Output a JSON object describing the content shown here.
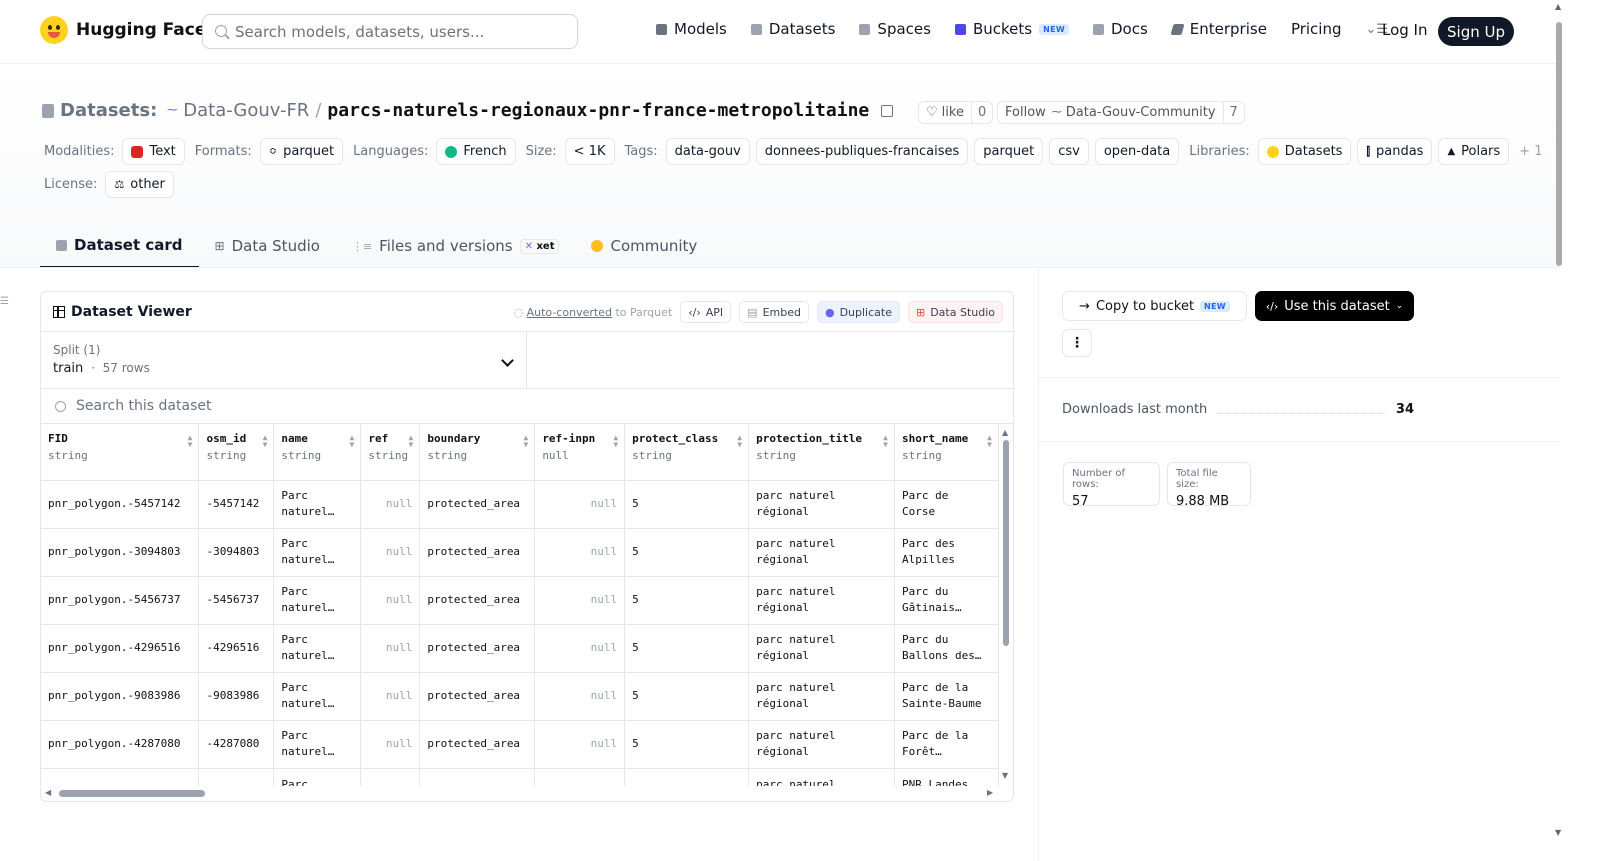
{
  "nav": {
    "brand": "Hugging Face",
    "search_placeholder": "Search models, datasets, users...",
    "items": [
      {
        "label": "Models",
        "icon": "models-icon",
        "color": "#6b7280"
      },
      {
        "label": "Datasets",
        "icon": "datasets-icon",
        "color": "#9ca3af"
      },
      {
        "label": "Spaces",
        "icon": "spaces-icon",
        "color": "#9ca3af"
      },
      {
        "label": "Buckets",
        "icon": "buckets-icon",
        "color": "#4f46e5",
        "badge": "NEW"
      },
      {
        "label": "Docs",
        "icon": "docs-icon",
        "color": "#9ca3af"
      },
      {
        "label": "Enterprise",
        "icon": "enterprise-icon",
        "color": "#6b7280"
      },
      {
        "label": "Pricing"
      }
    ],
    "login": "Log In",
    "signup": "Sign Up"
  },
  "repo": {
    "type_label": "Datasets:",
    "org": "Data-Gouv-FR",
    "slash": "/",
    "name": "parcs-naturels-regionaux-pnr-france-metropolitaine",
    "like_label": "like",
    "like_count": "0",
    "follow_label": "Follow",
    "follow_org": "Data-Gouv-Community",
    "follow_count": "7"
  },
  "tags": {
    "modalities_label": "Modalities:",
    "modalities": "Text",
    "formats_label": "Formats:",
    "formats": "parquet",
    "languages_label": "Languages:",
    "languages": "French",
    "size_label": "Size:",
    "size": "< 1K",
    "tags_label": "Tags:",
    "tags": [
      "data-gouv",
      "donnees-publiques-francaises",
      "parquet",
      "csv",
      "open-data"
    ],
    "libraries_label": "Libraries:",
    "libraries": [
      "Datasets",
      "pandas",
      "Polars"
    ],
    "libraries_more": "+ 1",
    "license_label": "License:",
    "license": "other"
  },
  "tabs": [
    {
      "label": "Dataset card",
      "active": true
    },
    {
      "label": "Data Studio"
    },
    {
      "label": "Files and versions",
      "badge": "xet"
    },
    {
      "label": "Community"
    }
  ],
  "viewer": {
    "title": "Dataset Viewer",
    "autoconverted": "Auto-converted",
    "to_parquet": "to Parquet",
    "api": "API",
    "embed": "Embed",
    "duplicate": "Duplicate",
    "data_studio": "Data Studio",
    "split_label": "Split (1)",
    "split_name": "train",
    "split_rows": "57 rows",
    "search_placeholder": "Search this dataset",
    "columns": [
      {
        "name": "FID",
        "type": "string"
      },
      {
        "name": "osm_id",
        "type": "string"
      },
      {
        "name": "name",
        "type": "string"
      },
      {
        "name": "ref",
        "type": "string"
      },
      {
        "name": "boundary",
        "type": "string"
      },
      {
        "name": "ref-inpn",
        "type": "null"
      },
      {
        "name": "protect_class",
        "type": "string"
      },
      {
        "name": "protection_title",
        "type": "string"
      },
      {
        "name": "short_name",
        "type": "string"
      }
    ],
    "rows": [
      [
        "pnr_polygon.-5457142",
        "-5457142",
        "Parc\nnaturel…",
        "null",
        "protected_area",
        "null",
        "5",
        "parc naturel\nrégional",
        "Parc de\nCorse"
      ],
      [
        "pnr_polygon.-3094803",
        "-3094803",
        "Parc\nnaturel…",
        "null",
        "protected_area",
        "null",
        "5",
        "parc naturel\nrégional",
        "Parc des\nAlpilles"
      ],
      [
        "pnr_polygon.-5456737",
        "-5456737",
        "Parc\nnaturel…",
        "null",
        "protected_area",
        "null",
        "5",
        "parc naturel\nrégional",
        "Parc du\nGâtinais…"
      ],
      [
        "pnr_polygon.-4296516",
        "-4296516",
        "Parc\nnaturel…",
        "null",
        "protected_area",
        "null",
        "5",
        "parc naturel\nrégional",
        "Parc du\nBallons des…"
      ],
      [
        "pnr_polygon.-9083986",
        "-9083986",
        "Parc\nnaturel…",
        "null",
        "protected_area",
        "null",
        "5",
        "parc naturel\nrégional",
        "Parc de la\nSainte-Baume"
      ],
      [
        "pnr_polygon.-4287080",
        "-4287080",
        "Parc\nnaturel…",
        "null",
        "protected_area",
        "null",
        "5",
        "parc naturel\nrégional",
        "Parc de la\nForêt…"
      ],
      [
        "",
        "",
        "Parc",
        "",
        "",
        "",
        "",
        "parc naturel",
        "PNR Landes"
      ]
    ]
  },
  "sidebar": {
    "copy_to_bucket": "Copy to bucket",
    "copy_badge": "NEW",
    "use_dataset": "Use this dataset",
    "downloads_label": "Downloads last month",
    "downloads_value": "34",
    "rows_label": "Number of rows:",
    "rows_value": "57",
    "size_label": "Total file size:",
    "size_value": "9.88 MB"
  }
}
